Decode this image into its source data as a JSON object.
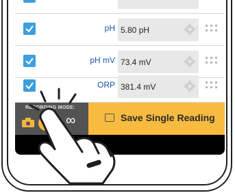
{
  "rows": [
    {
      "label": "pH",
      "value": "5.80 pH",
      "checked": true
    },
    {
      "label": "pH mV",
      "value": "73.4 mV",
      "checked": true
    },
    {
      "label": "ORP",
      "value": "381.4 mV",
      "checked": true
    }
  ],
  "recording_mode": {
    "label": "RECORDING MODE:",
    "continuous_symbol": "∞"
  },
  "save_button": {
    "label": "Save Single Reading"
  },
  "colors": {
    "checkbox": "#3d9fdd",
    "row_label": "#1a55a8",
    "save_button": "#f7bb3f",
    "mode_panel": "#535353"
  },
  "icons": [
    "checkbox-icon",
    "gear-icon",
    "drag-handle-icon",
    "camera-icon",
    "save-icon",
    "tap-hand-icon"
  ]
}
